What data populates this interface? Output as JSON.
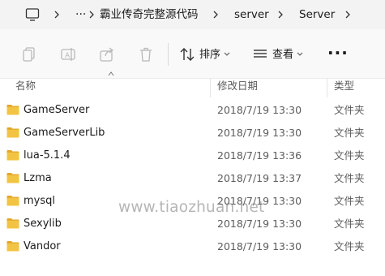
{
  "breadcrumb": {
    "overflow": "···",
    "items": [
      "霸业传奇完整源代码",
      "server",
      "Server"
    ]
  },
  "toolbar": {
    "sort_label": "排序",
    "view_label": "查看",
    "more": "···"
  },
  "columns": {
    "name": "名称",
    "modified": "修改日期",
    "type": "类型"
  },
  "files": [
    {
      "name": "GameServer",
      "modified": "2018/7/19 13:30",
      "type": "文件夹"
    },
    {
      "name": "GameServerLib",
      "modified": "2018/7/19 13:30",
      "type": "文件夹"
    },
    {
      "name": "lua-5.1.4",
      "modified": "2018/7/19 13:36",
      "type": "文件夹"
    },
    {
      "name": "Lzma",
      "modified": "2018/7/19 13:37",
      "type": "文件夹"
    },
    {
      "name": "mysql",
      "modified": "2018/7/19 13:30",
      "type": "文件夹"
    },
    {
      "name": "Sexylib",
      "modified": "2018/7/19 13:30",
      "type": "文件夹"
    },
    {
      "name": "Vandor",
      "modified": "2018/7/19 13:30",
      "type": "文件夹"
    }
  ],
  "watermark": "www.tiaozhuan.net",
  "colors": {
    "folder": "#f3c443",
    "folder_dark": "#e1a72a",
    "address_bg": "#f3f3f3",
    "toolbar_bg": "#f9f9f9"
  },
  "icons": {
    "computer": "monitor-icon",
    "copy": "copy-icon",
    "rename": "rename-icon",
    "share": "share-icon",
    "delete": "trash-icon",
    "sort": "sort-icon",
    "view": "view-icon",
    "folder": "folder-icon"
  }
}
